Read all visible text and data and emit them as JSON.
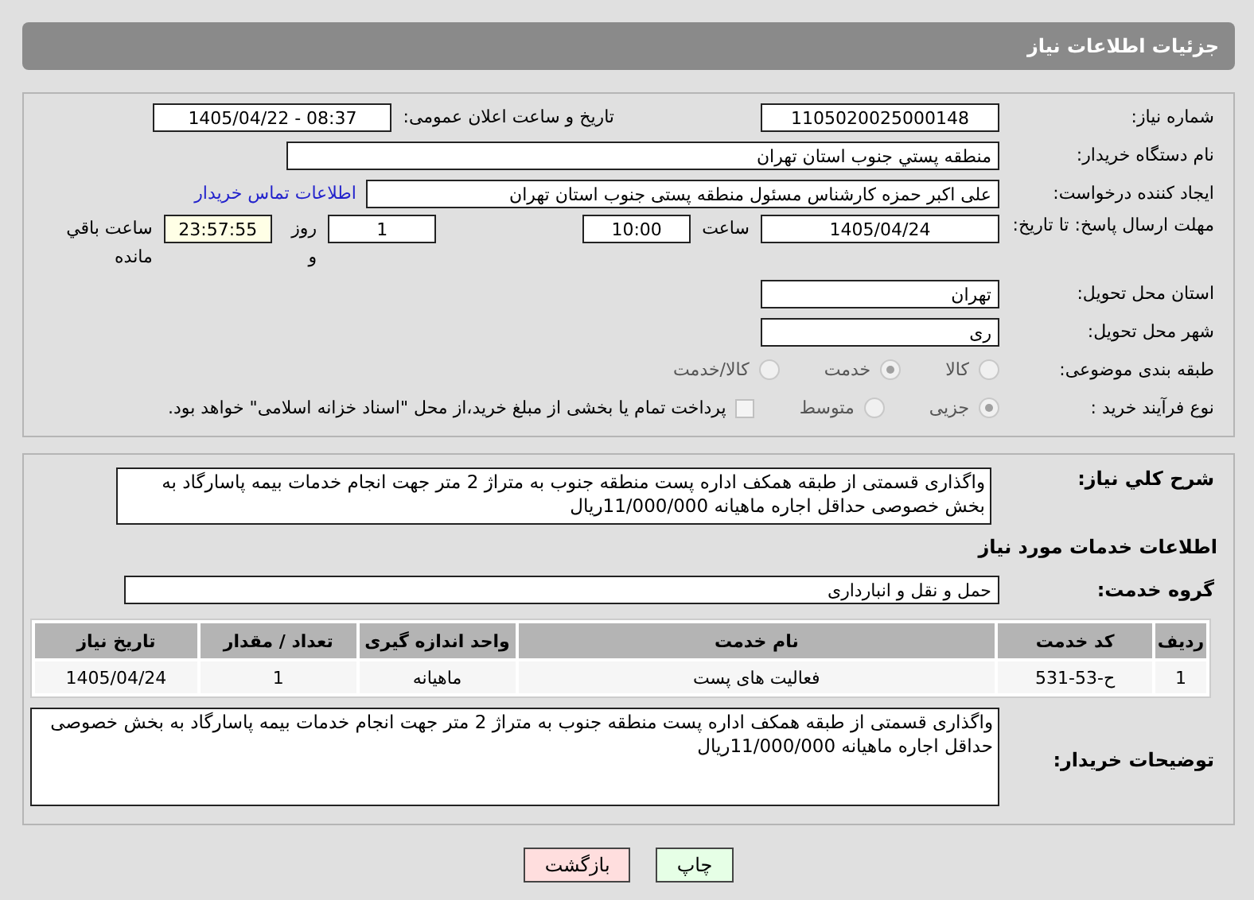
{
  "header": {
    "title": "جزئیات اطلاعات نیاز"
  },
  "need_number": {
    "label": "شماره نیاز:",
    "value": "1105020025000148"
  },
  "announce": {
    "label": "تاریخ و ساعت اعلان عمومی:",
    "value": "1405/04/22 - 08:37"
  },
  "buyer_org": {
    "label": "نام دستگاه خریدار:",
    "value": "منطقه پستي جنوب استان تهران"
  },
  "requester": {
    "label": "ایجاد کننده درخواست:",
    "value": "علی اکبر حمزه کارشناس مسئول منطقه پستی جنوب استان تهران",
    "link": "اطلاعات تماس خریدار"
  },
  "deadline": {
    "label": "مهلت ارسال پاسخ: تا تاریخ:",
    "date": "1405/04/24",
    "time_label": "ساعت",
    "time": "10:00",
    "days": "1",
    "days_label": "روز و",
    "remaining": "23:57:55",
    "remaining_label": "ساعت باقي مانده"
  },
  "province": {
    "label": "استان محل تحویل:",
    "value": "تهران"
  },
  "city": {
    "label": "شهر محل تحویل:",
    "value": "ری"
  },
  "category": {
    "label": "طبقه بندی موضوعی:",
    "options": [
      {
        "label": "کالا",
        "selected": false
      },
      {
        "label": "خدمت",
        "selected": true
      },
      {
        "label": "کالا/خدمت",
        "selected": false
      }
    ]
  },
  "purchase_process": {
    "label": "نوع فرآیند خرید :",
    "options": [
      {
        "label": "جزیی",
        "selected": true
      },
      {
        "label": "متوسط",
        "selected": false
      }
    ],
    "payment": {
      "checked": false,
      "text": "پرداخت تمام يا بخشی از مبلغ خرید،از محل \"اسناد خزانه اسلامی\" خواهد بود."
    }
  },
  "description": {
    "label": "شرح کلي نیاز:",
    "value": "واگذاری قسمتی از طبقه همکف اداره پست منطقه جنوب به متراژ 2 متر جهت انجام خدمات بیمه پاسارگاد به بخش خصوصی حداقل اجاره ماهیانه 11/000/000ریال"
  },
  "services_heading": "اطلاعات خدمات مورد نیاز",
  "service_group": {
    "label": "گروه خدمت:",
    "value": "حمل و نقل و انبارداری"
  },
  "table": {
    "columns": [
      "ردیف",
      "کد خدمت",
      "نام خدمت",
      "واحد اندازه گیری",
      "تعداد / مقدار",
      "تاریخ نیاز"
    ],
    "rows": [
      [
        "1",
        "ح-53-531",
        "فعالیت های پست",
        "ماهیانه",
        "1",
        "1405/04/24"
      ]
    ]
  },
  "buyer_notes": {
    "label": "توضیحات خریدار:",
    "value": "واگذاری قسمتی از طبقه همکف اداره پست منطقه جنوب به متراژ 2 متر جهت انجام خدمات بیمه پاسارگاد به بخش خصوصی حداقل اجاره ماهیانه 11/000/000ریال"
  },
  "buttons": [
    {
      "label": "چاپ",
      "kind": "print"
    },
    {
      "label": "بازگشت",
      "kind": "back"
    }
  ]
}
